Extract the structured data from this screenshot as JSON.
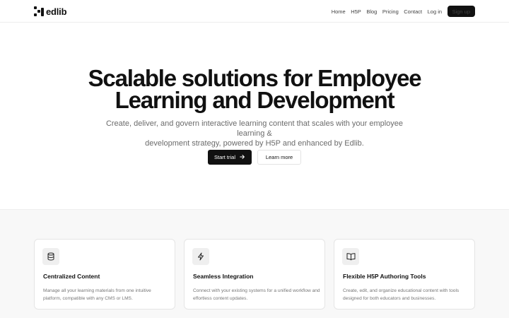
{
  "brand": {
    "name": "edlib"
  },
  "nav": {
    "items": [
      "Home",
      "H5P",
      "Blog",
      "Pricing",
      "Contact",
      "Log in"
    ],
    "signup_label": "Sign up"
  },
  "hero": {
    "title_line1": "Scalable solutions for Employee",
    "title_line2": "Learning and Development",
    "subtitle_line1": "Create, deliver, and govern interactive learning content that scales with your employee learning &",
    "subtitle_line2": "development strategy, powered by H5P and enhanced by Edlib.",
    "primary_label": "Start trial",
    "secondary_label": "Learn more"
  },
  "features": [
    {
      "icon": "database-icon",
      "title": "Centralized Content",
      "desc": "Manage all your learning materials from one intuitive platform, compatible with any CMS or LMS."
    },
    {
      "icon": "lightning-icon",
      "title": "Seamless Integration",
      "desc": "Connect with your existing systems for a unified workflow and effortless content updates."
    },
    {
      "icon": "book-open-icon",
      "title": "Flexible H5P Authoring Tools",
      "desc": "Create, edit, and organize educational content with tools designed for both educators and businesses."
    }
  ],
  "colors": {
    "primary": "#111111",
    "muted_text": "#6b6b6b",
    "section_bg": "#f8f8f8"
  }
}
